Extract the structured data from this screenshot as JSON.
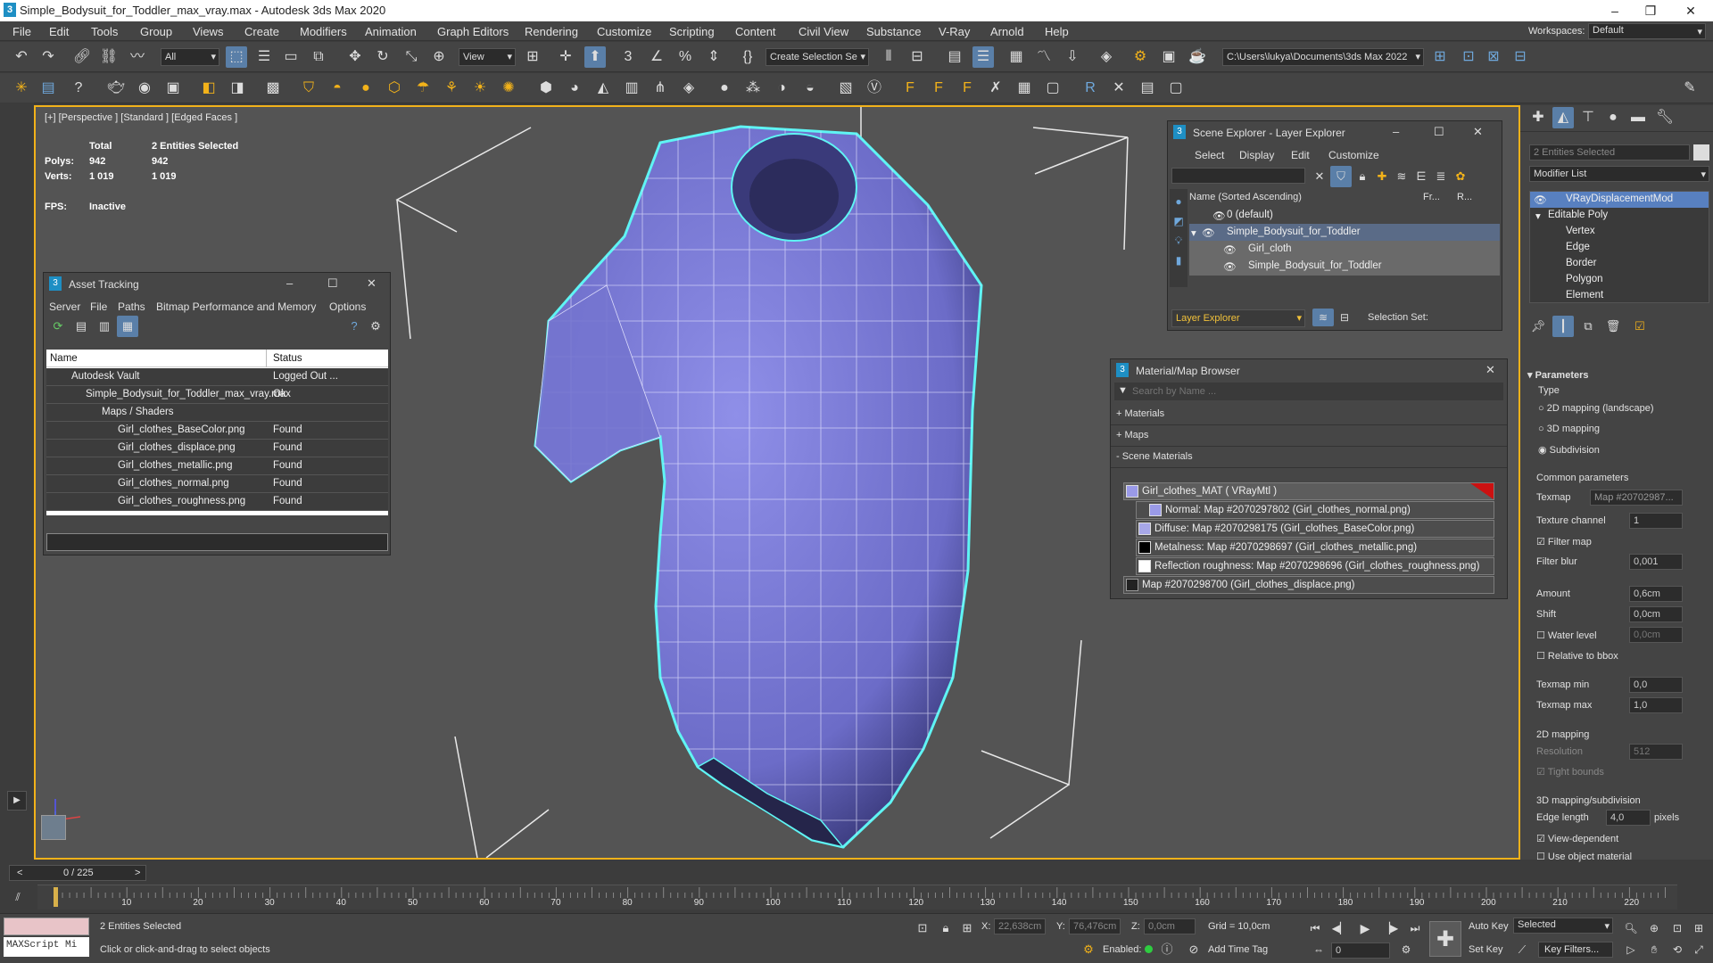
{
  "window": {
    "title": "Simple_Bodysuit_for_Toddler_max_vray.max - Autodesk 3ds Max 2020",
    "workspace_label": "Workspaces:",
    "workspace_value": "Default"
  },
  "menu": [
    "File",
    "Edit",
    "Tools",
    "Group",
    "Views",
    "Create",
    "Modifiers",
    "Animation",
    "Graph Editors",
    "Rendering",
    "Customize",
    "Scripting",
    "Content",
    "Civil View",
    "Substance",
    "V-Ray",
    "Arnold",
    "Help"
  ],
  "toolbar": {
    "filter": "All",
    "view": "View",
    "selection_set": "Create Selection Se",
    "path": "C:\\Users\\lukya\\Documents\\3ds Max 2022"
  },
  "viewport": {
    "label": "[+] [Perspective ] [Standard ] [Edged Faces ]",
    "stats_total": "Total",
    "stats_selected": "2 Entities Selected",
    "polys_label": "Polys:",
    "polys_total": "942",
    "polys_sel": "942",
    "verts_label": "Verts:",
    "verts_total": "1 019",
    "verts_sel": "1 019",
    "fps_label": "FPS:",
    "fps_value": "Inactive"
  },
  "asset_tracking": {
    "title": "Asset Tracking",
    "menu": [
      "Server",
      "File",
      "Paths",
      "Bitmap Performance and Memory",
      "Options"
    ],
    "col_name": "Name",
    "col_status": "Status",
    "rows": [
      {
        "name": "Autodesk Vault",
        "status": "Logged Out ..."
      },
      {
        "name": "Simple_Bodysuit_for_Toddler_max_vray.max",
        "status": "Ok"
      },
      {
        "name": "Maps / Shaders",
        "status": ""
      },
      {
        "name": "Girl_clothes_BaseColor.png",
        "status": "Found"
      },
      {
        "name": "Girl_clothes_displace.png",
        "status": "Found"
      },
      {
        "name": "Girl_clothes_metallic.png",
        "status": "Found"
      },
      {
        "name": "Girl_clothes_normal.png",
        "status": "Found"
      },
      {
        "name": "Girl_clothes_roughness.png",
        "status": "Found"
      }
    ]
  },
  "scene_explorer": {
    "title": "Scene Explorer - Layer Explorer",
    "menu": [
      "Select",
      "Display",
      "Edit",
      "Customize"
    ],
    "col_name": "Name (Sorted Ascending)",
    "col_fr": "Fr...",
    "col_r": "R...",
    "rows": [
      {
        "name": "0 (default)"
      },
      {
        "name": "Simple_Bodysuit_for_Toddler"
      },
      {
        "name": "Girl_cloth"
      },
      {
        "name": "Simple_Bodysuit_for_Toddler"
      }
    ],
    "footer_layer": "Layer Explorer",
    "footer_selset": "Selection Set:"
  },
  "material_browser": {
    "title": "Material/Map Browser",
    "search_placeholder": "Search by Name ...",
    "materials": "+ Materials",
    "maps": "+ Maps",
    "scene_materials": "- Scene Materials",
    "rows": [
      {
        "name": "Girl_clothes_MAT  ( VRayMtl )"
      },
      {
        "name": "Normal: Map #2070297802 (Girl_clothes_normal.png)"
      },
      {
        "name": "Diffuse: Map #2070298175 (Girl_clothes_BaseColor.png)"
      },
      {
        "name": "Metalness: Map #2070298697 (Girl_clothes_metallic.png)"
      },
      {
        "name": "Reflection roughness: Map #2070298696 (Girl_clothes_roughness.png)"
      },
      {
        "name": "Map #2070298700 (Girl_clothes_displace.png)"
      }
    ]
  },
  "command_panel": {
    "selection": "2 Entities Selected",
    "modifier_list": "Modifier List",
    "stack": [
      "VRayDisplacementMod",
      "Editable Poly",
      "Vertex",
      "Edge",
      "Border",
      "Polygon",
      "Element"
    ],
    "parameters": "Parameters",
    "type_label": "Type",
    "type_options": [
      "2D mapping (landscape)",
      "3D mapping",
      "Subdivision"
    ],
    "common_params": "Common parameters",
    "texmap_label": "Texmap",
    "texmap_value": "Map #20702987...",
    "texchannel_label": "Texture channel",
    "texchannel_value": "1",
    "filter_map": "Filter map",
    "filter_blur_label": "Filter blur",
    "filter_blur_value": "0,001",
    "amount_label": "Amount",
    "amount_value": "0,6cm",
    "shift_label": "Shift",
    "shift_value": "0,0cm",
    "water_label": "Water level",
    "water_value": "0,0cm",
    "relative_bbox": "Relative to bbox",
    "texmap_min_label": "Texmap min",
    "texmap_min_value": "0,0",
    "texmap_max_label": "Texmap max",
    "texmap_max_value": "1,0",
    "mapping2d": "2D mapping",
    "resolution_label": "Resolution",
    "resolution_value": "512",
    "tight_bounds": "Tight bounds",
    "mapping3d": "3D mapping/subdivision",
    "edge_length_label": "Edge length",
    "edge_length_value": "4,0",
    "pixels": "pixels",
    "view_dependent": "View-dependent",
    "use_object_material": "Use object material"
  },
  "timeline": {
    "frame": "0 / 225",
    "ticks": [
      "10",
      "20",
      "30",
      "40",
      "50",
      "60",
      "70",
      "80",
      "90",
      "100",
      "110",
      "120",
      "130",
      "140",
      "150",
      "160",
      "170",
      "180",
      "190",
      "200",
      "210",
      "220"
    ]
  },
  "status": {
    "maxscript": "MAXScript Mi",
    "selected": "2 Entities Selected",
    "prompt": "Click or click-and-drag to select objects",
    "x_label": "X:",
    "x_value": "22,638cm",
    "y_label": "Y:",
    "y_value": "76,476cm",
    "z_label": "Z:",
    "z_value": "0,0cm",
    "grid": "Grid = 10,0cm",
    "enabled": "Enabled:",
    "add_time_tag": "Add Time Tag",
    "auto_key": "Auto Key",
    "set_key": "Set Key",
    "selected_dd": "Selected",
    "key_filters": "Key Filters...",
    "frame_field": "0"
  }
}
